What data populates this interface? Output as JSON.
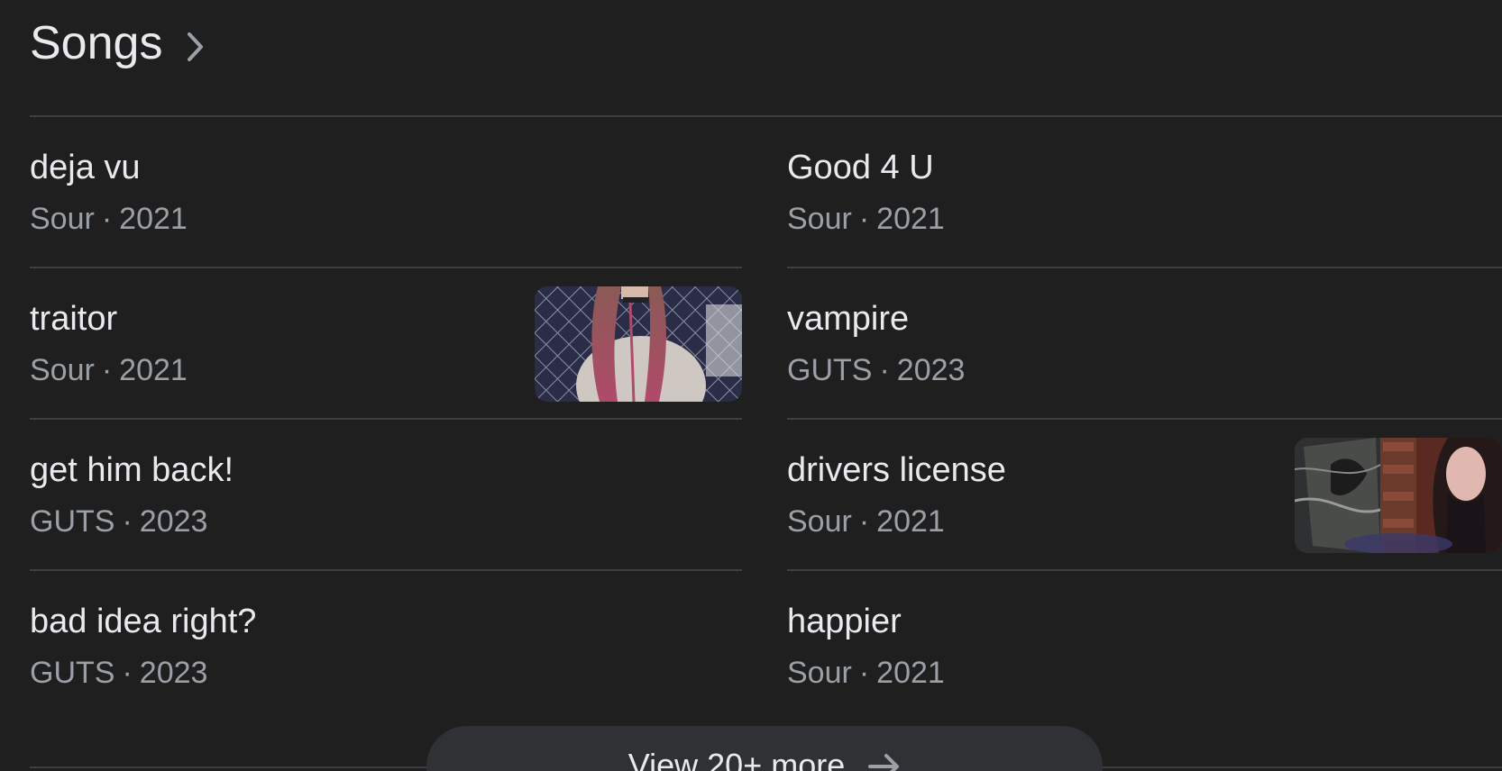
{
  "section": {
    "title": "Songs",
    "chevron_icon": "chevron-right-icon"
  },
  "colors": {
    "background": "#1f1f1f",
    "title_text": "#e8eaed",
    "meta_text": "#9aa0a6",
    "divider": "#3c4043",
    "button_bg": "#303134"
  },
  "songs_left": [
    {
      "title": "deja vu",
      "album": "Sour",
      "year": "2021",
      "has_thumbnail": false
    },
    {
      "title": "traitor",
      "album": "Sour",
      "year": "2021",
      "has_thumbnail": true
    },
    {
      "title": "get him back!",
      "album": "GUTS",
      "year": "2023",
      "has_thumbnail": false
    },
    {
      "title": "bad idea right?",
      "album": "GUTS",
      "year": "2023",
      "has_thumbnail": false
    }
  ],
  "songs_right": [
    {
      "title": "Good 4 U",
      "album": "Sour",
      "year": "2021",
      "has_thumbnail": false
    },
    {
      "title": "vampire",
      "album": "GUTS",
      "year": "2023",
      "has_thumbnail": false
    },
    {
      "title": "drivers license",
      "album": "Sour",
      "year": "2021",
      "has_thumbnail": true
    },
    {
      "title": "happier",
      "album": "Sour",
      "year": "2021",
      "has_thumbnail": false
    }
  ],
  "separator": "·",
  "view_more": {
    "label": "View 20+ more",
    "icon": "arrow-right-icon"
  }
}
